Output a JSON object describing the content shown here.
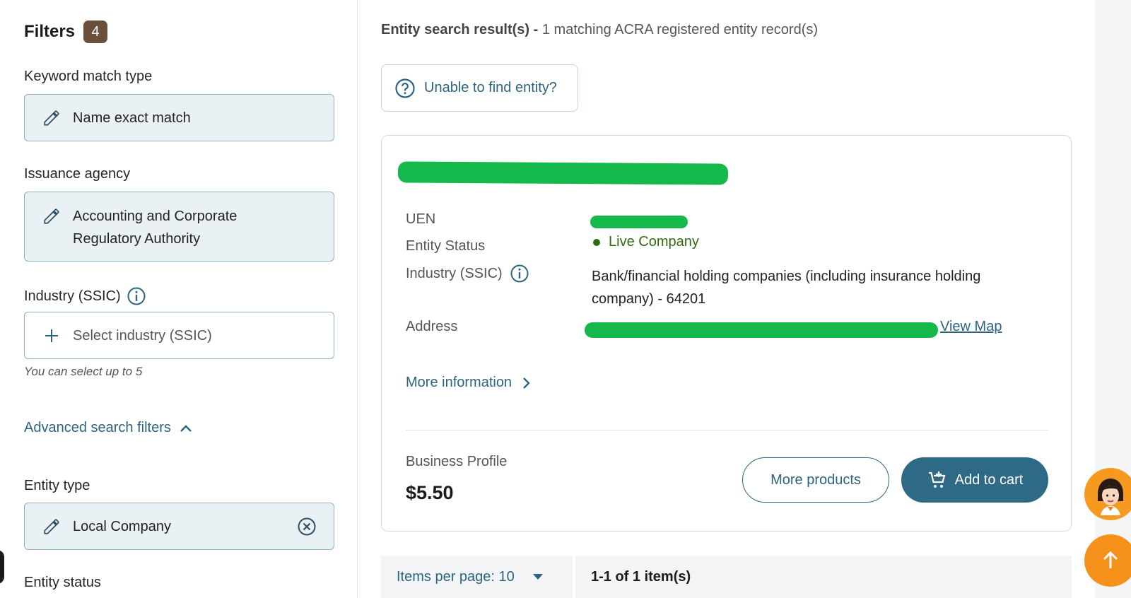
{
  "filters": {
    "title": "Filters",
    "count": "4",
    "keyword": {
      "label": "Keyword match type",
      "value": "Name exact match"
    },
    "agency": {
      "label": "Issuance agency",
      "value": "Accounting and Corporate Regulatory Authority"
    },
    "industry": {
      "label": "Industry (SSIC)",
      "placeholder": "Select industry (SSIC)",
      "hint": "You can select up to 5"
    },
    "advanced": "Advanced search filters",
    "entity_type": {
      "label": "Entity type",
      "value": "Local Company"
    },
    "entity_status": {
      "label": "Entity status"
    }
  },
  "results": {
    "title_bold": "Entity search result(s) -",
    "title_rest": " 1 matching ACRA registered entity record(s)",
    "unable": "Unable to find entity?"
  },
  "entity": {
    "uen_label": "UEN",
    "status_label": "Entity Status",
    "status_value": "Live Company",
    "industry_label": "Industry (SSIC)",
    "industry_value": "Bank/financial holding companies (including insurance holding company) - 64201",
    "address_label": "Address",
    "view_map": "View Map",
    "more_info": "More information",
    "product_name": "Business Profile",
    "price": "$5.50",
    "more_products": "More products",
    "add_to_cart": "Add to cart"
  },
  "pagination": {
    "per_page": "Items per page: 10",
    "range": "1-1 of 1 item(s)"
  },
  "colors": {
    "accent": "#2c6480",
    "primary_button": "#2e6a86",
    "badge": "#6a4f3a",
    "status_live": "#2f6b12",
    "redaction": "#14b84b",
    "fab": "#f59a1e"
  }
}
